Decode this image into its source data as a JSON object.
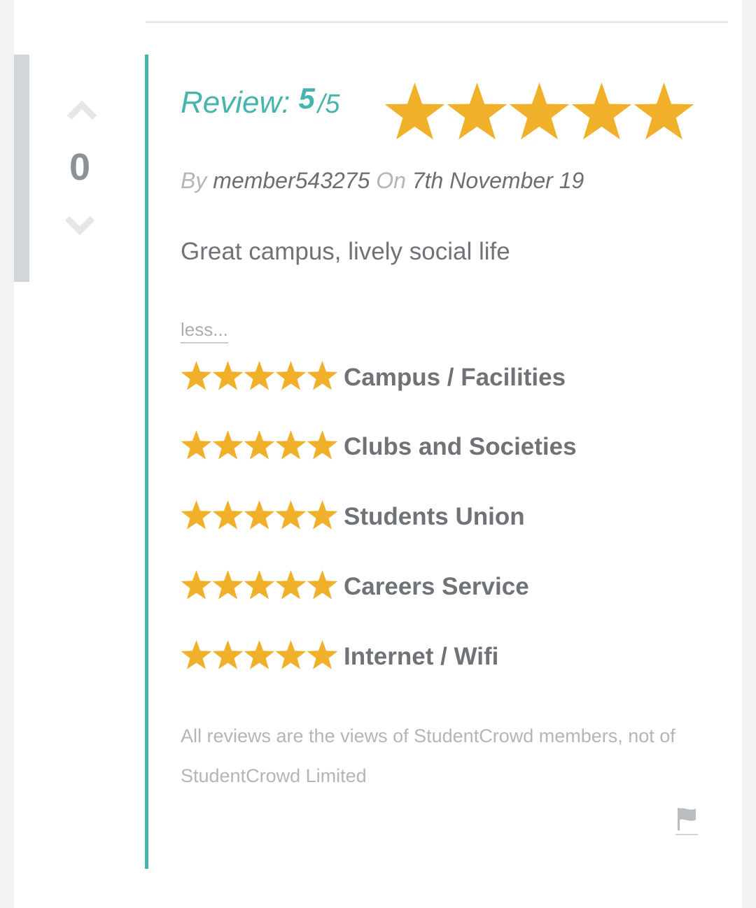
{
  "vote": {
    "count": "0"
  },
  "review": {
    "label": "Review:",
    "score": "5",
    "slash": "/",
    "max": "5",
    "overall_rating": 5,
    "by_label": "By",
    "author": "member543275",
    "on_label": "On",
    "date": "7th November 19",
    "text": "Great campus, lively social life",
    "less_link": "less..."
  },
  "ratings": [
    {
      "label": "Campus / Facilities",
      "stars": 5
    },
    {
      "label": "Clubs and Societies",
      "stars": 5
    },
    {
      "label": "Students Union",
      "stars": 5
    },
    {
      "label": "Careers Service",
      "stars": 5
    },
    {
      "label": "Internet / Wifi",
      "stars": 5
    }
  ],
  "disclaimer": "All reviews are the views of StudentCrowd members, not of StudentCrowd Limited",
  "colors": {
    "accent": "#48b5ac",
    "star": "#f1b02a",
    "text_dark": "#6f7377",
    "text_muted": "#b2b6ba"
  },
  "icons": {
    "vote_up": "chevron-up-icon",
    "vote_down": "chevron-down-icon",
    "star": "star-icon",
    "report": "flag-icon"
  }
}
